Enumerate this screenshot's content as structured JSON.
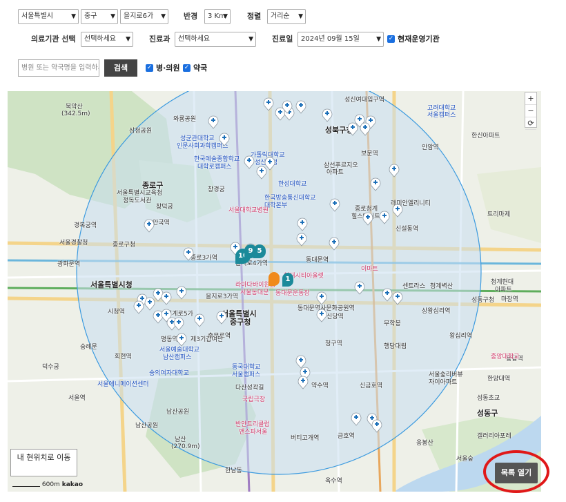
{
  "filters": {
    "sido": "서울특별시",
    "sigungu": "중구",
    "dong": "을지로6가",
    "radius_label": "반경",
    "radius": "3 Km",
    "sort_label": "정렬",
    "sort": "거리순",
    "facility_label": "의료기관 선택",
    "facility": "선택하세요",
    "dept_label": "진료과",
    "dept": "선택하세요",
    "date_label": "진료일",
    "date": "2024년 09월 15일",
    "operating_label": "현재운영기관",
    "search_placeholder": "병원 또는 약국명을 입력하세요",
    "search_button": "검색",
    "hospital_label": "병·의원",
    "pharmacy_label": "약국"
  },
  "map": {
    "labels": [
      "북악산",
      "(342.5m)",
      "와룡공원",
      "삼청공원",
      "성균관대학교",
      "인문사회과학캠퍼스",
      "한국예술종합학교",
      "대학로캠퍼스",
      "가톨릭대학교",
      "성신교정",
      "성신여대입구역",
      "성북구청",
      "보문역",
      "삼선푸르지오",
      "아파트",
      "고려대학교",
      "서울캠퍼스",
      "안암역",
      "한신아파트",
      "서울특별시교육청",
      "정독도서관",
      "종로구",
      "창덕궁",
      "창경궁",
      "서울대학교병원",
      "한성대학교",
      "한국방송통신대학교",
      "대학본부",
      "종로청계",
      "힐스테이트",
      "래미안엘리니티",
      "신설동역",
      "경복궁역",
      "안국역",
      "종로3가역",
      "종로구청",
      "서울경찰청",
      "광화문역",
      "서울특별시청",
      "시청역",
      "을지로3가역",
      "을지로4가역",
      "동대문역",
      "라마다바이윈덤",
      "서울동대문",
      "동대문역사문화공원역",
      "동대문운동장",
      "현대시티아울렛",
      "서울특별시",
      "중구청",
      "신당역",
      "약수역",
      "청구역",
      "다산성곽길",
      "충무로역",
      "동국대학교",
      "서울캠퍼스",
      "국립극장",
      "반얀트리클럽",
      "앤스파서울",
      "남산공원",
      "남산",
      "(270.9m)",
      "금호역",
      "버티고개역",
      "한남동",
      "옥수역",
      "응봉산",
      "성동구",
      "왕십리역",
      "상왕십리역",
      "신금호역",
      "이마트",
      "청계벽산",
      "센트라스",
      "성동구청",
      "행당대림",
      "서울숲리버뷰",
      "자이아파트",
      "성동초교",
      "갤러리아포레",
      "서울숲",
      "용답역",
      "한양대역",
      "청계현대",
      "아파트",
      "마장역",
      "트리마제",
      "중앙대학교",
      "무학봉",
      "덕수궁",
      "서울역",
      "숭례문",
      "서울예술대학교",
      "남산캠퍼스",
      "숭의여자대학교",
      "퇴계로5가",
      "명동역",
      "회현역",
      "남산공원",
      "서울애니메이션센터",
      "제3기갑여단"
    ],
    "cluster_counts": [
      "10",
      "9",
      "5",
      "1"
    ]
  },
  "controls": {
    "zoom_in": "+",
    "zoom_out": "−",
    "refresh": "⟳",
    "my_location": "내 현위치로 이동",
    "list_open": "목록 열기",
    "scale_label": "600m",
    "brand": "kakao"
  },
  "colors": {
    "accent": "#1a6fe0",
    "radius_fill": "#c9def0",
    "radius_stroke": "#3b9adf",
    "marker": "#ffffff",
    "cluster": "#1b8a9a",
    "highlight": "#e01818"
  }
}
